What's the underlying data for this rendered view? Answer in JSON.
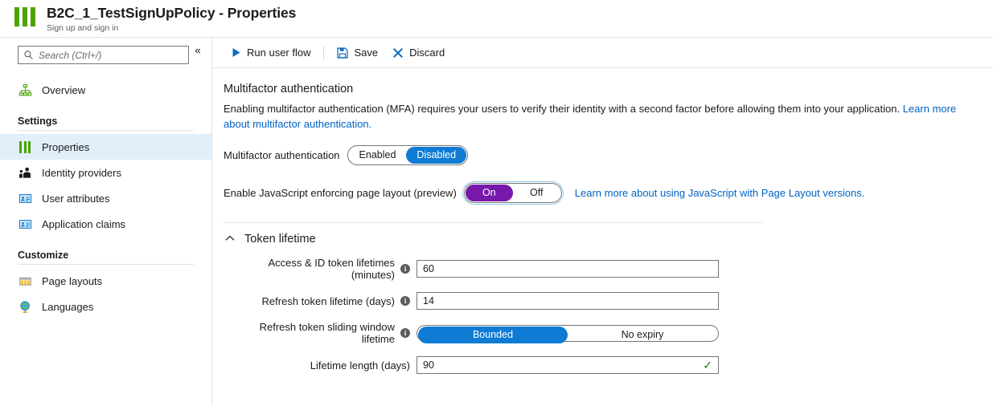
{
  "header": {
    "icon": "properties-bars-icon",
    "title": "B2C_1_TestSignUpPolicy - Properties",
    "subtitle": "Sign up and sign in"
  },
  "sidebar": {
    "search": {
      "placeholder": "Search (Ctrl+/)",
      "value": "",
      "icon": "search-icon"
    },
    "collapse_label": "«",
    "top_items": [
      {
        "label": "Overview",
        "icon": "overview-hierarchy-icon"
      }
    ],
    "sections": [
      {
        "title": "Settings",
        "items": [
          {
            "label": "Properties",
            "icon": "properties-bars-icon",
            "active": true
          },
          {
            "label": "Identity providers",
            "icon": "identity-providers-icon",
            "active": false
          },
          {
            "label": "User attributes",
            "icon": "user-attributes-card-icon",
            "active": false
          },
          {
            "label": "Application claims",
            "icon": "application-claims-card-icon",
            "active": false
          }
        ]
      },
      {
        "title": "Customize",
        "items": [
          {
            "label": "Page layouts",
            "icon": "page-layouts-grid-icon",
            "active": false
          },
          {
            "label": "Languages",
            "icon": "languages-globe-icon",
            "active": false
          }
        ]
      }
    ]
  },
  "toolbar": {
    "run_label": "Run user flow",
    "run_icon": "play-icon",
    "save_label": "Save",
    "save_icon": "save-disk-icon",
    "discard_label": "Discard",
    "discard_icon": "close-x-icon"
  },
  "main": {
    "mfa": {
      "heading": "Multifactor authentication",
      "description": "Enabling multifactor authentication (MFA) requires your users to verify their identity with a second factor before allowing them into your application. ",
      "link_text": "Learn more about multifactor authentication.",
      "field_label": "Multifactor authentication",
      "options": [
        "Enabled",
        "Disabled"
      ],
      "selected": "Disabled"
    },
    "javascript": {
      "field_label": "Enable JavaScript enforcing page layout (preview)",
      "options": [
        "On",
        "Off"
      ],
      "selected": "On",
      "link_text": "Learn more about using JavaScript with Page Layout versions."
    },
    "token_lifetime": {
      "title": "Token lifetime",
      "expanded": true,
      "chevron": "˄",
      "fields": [
        {
          "label": "Access & ID token lifetimes (minutes)",
          "has_info": true,
          "type": "text",
          "value": "60",
          "valid": false
        },
        {
          "label": "Refresh token lifetime (days)",
          "has_info": true,
          "type": "text",
          "value": "14",
          "valid": false
        },
        {
          "label": "Refresh token sliding window lifetime",
          "has_info": true,
          "type": "choice",
          "options": [
            "Bounded",
            "No expiry"
          ],
          "selected": "Bounded"
        },
        {
          "label": "Lifetime length (days)",
          "has_info": false,
          "type": "text",
          "value": "90",
          "valid": true
        }
      ]
    }
  },
  "colors": {
    "brand_green": "#4ca300",
    "accent_blue": "#0f7bd4",
    "link_blue": "#0062c5",
    "purple": "#7719aa",
    "valid_green": "#107c10",
    "active_row": "#e1effa"
  }
}
